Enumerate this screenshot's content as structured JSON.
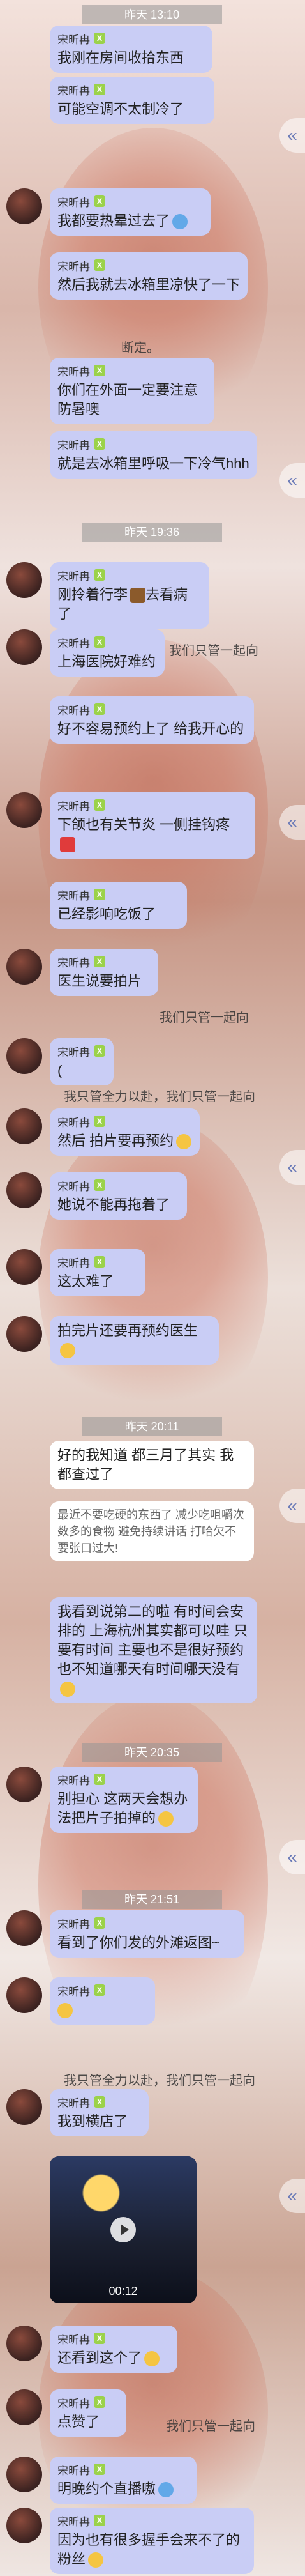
{
  "timestamps": [
    "昨天 13:10",
    "昨天 19:36",
    "昨天 20:11",
    "昨天 20:35",
    "昨天 21:51"
  ],
  "sender": {
    "name": "宋昕冉",
    "badge": "X"
  },
  "ghost_text": {
    "cropped_1": "断定。",
    "cropped_2": "。我们只管一起向",
    "cropped_3": "我们只管一起向",
    "cropped_4": "我只管全力以赴，我们只管一起向",
    "cropped_5": "我们只管一起向",
    "cropped_6": "我只管全力以赴，我们只管一起向"
  },
  "messages": [
    {
      "text": "我刚在房间收拾东西"
    },
    {
      "text": "可能空调不太制冷了"
    },
    {
      "text": "我都要热晕过去了"
    },
    {
      "text": "然后我就去冰箱里凉快了一下"
    },
    {
      "text": "你们在外面一定要注意防暑噢"
    },
    {
      "text": "就是去冰箱里呼吸一下冷气hhh"
    },
    {
      "text": "刚拎着行李"
    },
    {
      "text": "去看病了"
    },
    {
      "text": "上海医院好难约"
    },
    {
      "text": "好不容易预约上了 给我开心的"
    },
    {
      "text": "下颌也有关节炎 一侧挂钩疼"
    },
    {
      "text": "已经影响吃饭了"
    },
    {
      "text": "医生说要拍片"
    },
    {
      "text": "("
    },
    {
      "text": "然后 拍片要再预约"
    },
    {
      "text": "她说不能再拖着了"
    },
    {
      "text": "这太难了"
    },
    {
      "text": "拍完片还要再预约医生"
    },
    {
      "text": "好的我知道 都三月了其实 我都查过了"
    },
    {
      "text": "最近不要吃硬的东西了 减少吃咀嚼次数多的食物 避免持续讲话 打哈欠不要张口过大!"
    },
    {
      "text": "我看到说第二的啦 有时间会安排的 上海杭州其实都可以哇 只要有时间 主要也不是很好预约 也不知道哪天有时间哪天没有"
    },
    {
      "text": "别担心 这两天会想办法把片子拍掉的"
    },
    {
      "text": "看到了你们发的外滩返图~"
    },
    {
      "text": "我到横店了"
    },
    {
      "text": "还看到这个了"
    },
    {
      "text": "点赞了"
    },
    {
      "text": "明晚约个直播嗷"
    },
    {
      "text": "因为也有很多握手会来不了的粉丝"
    }
  ],
  "video": {
    "duration": "00:12"
  }
}
